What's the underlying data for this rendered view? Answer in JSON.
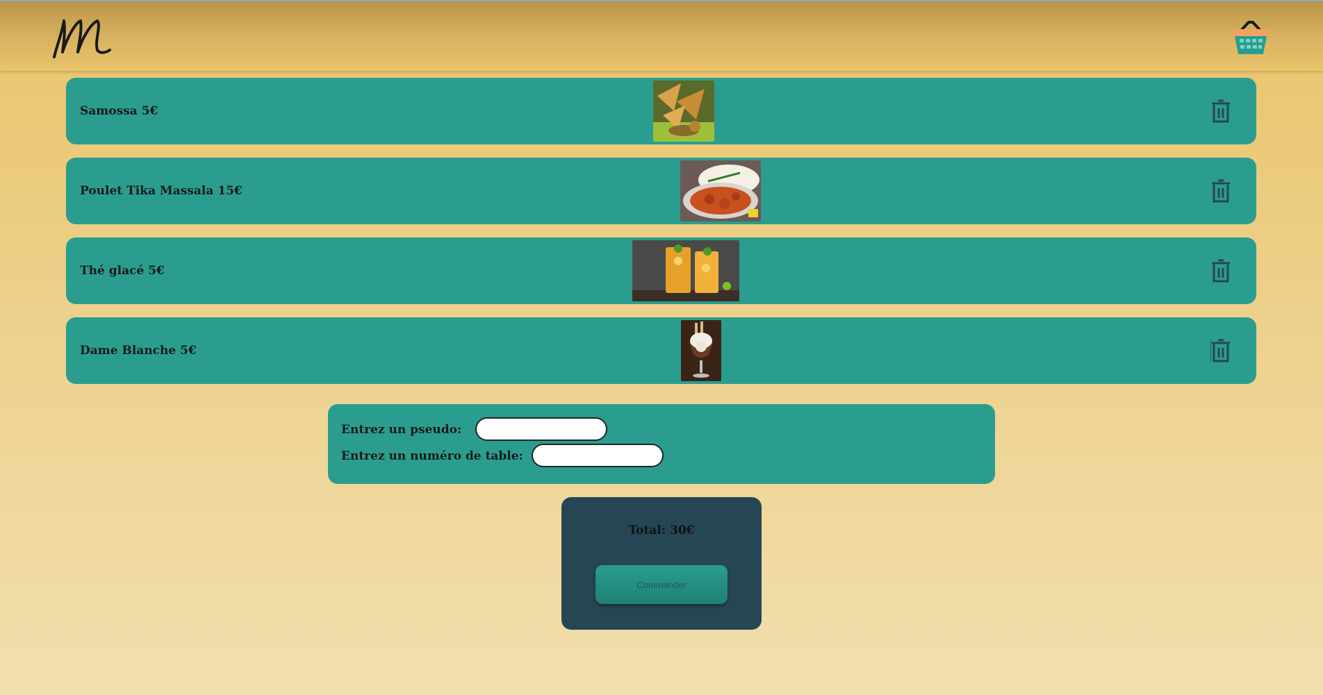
{
  "header": {
    "logo_text": "m",
    "basket_icon": "basket-icon"
  },
  "colors": {
    "row_bg": "#2a9d8f",
    "total_bg": "#264653",
    "page_gold": "#e9c46a",
    "basket_orange": "#f4a261"
  },
  "cart": {
    "items": [
      {
        "label": "Samossa 5€",
        "photo": "samosa-photo"
      },
      {
        "label": "Poulet Tika Massala 15€",
        "photo": "chicken-tikka-masala-photo"
      },
      {
        "label": "Thé glacé 5€",
        "photo": "iced-tea-photo"
      },
      {
        "label": "Dame Blanche 5€",
        "photo": "dame-blanche-sundae-photo"
      }
    ],
    "delete_icon": "trash-icon"
  },
  "form": {
    "pseudo_label": "Entrez un pseudo:",
    "pseudo_value": "",
    "table_label": "Entrez un numéro de table:",
    "table_value": ""
  },
  "summary": {
    "total_text": "Total: 30€",
    "order_button": "Commander"
  }
}
